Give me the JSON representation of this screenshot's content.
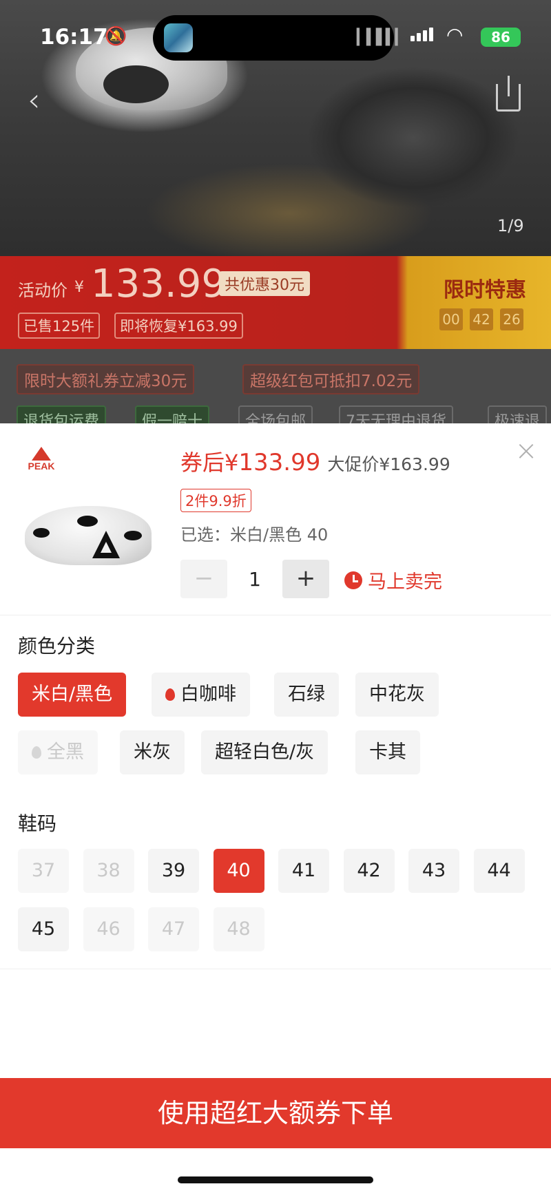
{
  "status_bar": {
    "time": "16:17",
    "battery": "86"
  },
  "gallery": {
    "pager": "1/9"
  },
  "promo": {
    "label": "活动价",
    "yen": "¥",
    "price": "133.99",
    "save_badge": "共优惠30元",
    "sold": "已售125件",
    "restore": "即将恢复¥163.99",
    "flash_title": "限时特惠",
    "countdown": [
      "00",
      "42",
      "26"
    ]
  },
  "coupons": [
    "限时大额礼券立减30元",
    "超级红包可抵扣7.02元"
  ],
  "services": [
    "退货包运费",
    "假一赔十",
    "全场包邮",
    "7天无理由退货",
    "极速退"
  ],
  "sheet": {
    "brand": "PEAK",
    "coupon_price_prefix": "券后¥",
    "coupon_price": "133.99",
    "original_price": "大促价¥163.99",
    "discount_tag": "2件9.9折",
    "selected": "已选：米白/黑色 40",
    "minus": "−",
    "quantity": "1",
    "plus": "+",
    "sold_out_hint": "马上卖完",
    "color_title": "颜色分类",
    "colors": [
      {
        "label": "米白/黑色",
        "state": "selected",
        "hot": false
      },
      {
        "label": "白咖啡",
        "state": "normal",
        "hot": true
      },
      {
        "label": "石绿",
        "state": "normal",
        "hot": false
      },
      {
        "label": "中花灰",
        "state": "normal",
        "hot": false
      },
      {
        "label": "全黑",
        "state": "disabled",
        "hot": true
      },
      {
        "label": "米灰",
        "state": "normal",
        "hot": false
      },
      {
        "label": "超轻白色/灰",
        "state": "normal",
        "hot": false
      },
      {
        "label": "卡其",
        "state": "normal",
        "hot": false
      }
    ],
    "size_title": "鞋码",
    "sizes": [
      {
        "label": "37",
        "state": "disabled"
      },
      {
        "label": "38",
        "state": "disabled"
      },
      {
        "label": "39",
        "state": "normal"
      },
      {
        "label": "40",
        "state": "selected"
      },
      {
        "label": "41",
        "state": "normal"
      },
      {
        "label": "42",
        "state": "normal"
      },
      {
        "label": "43",
        "state": "normal"
      },
      {
        "label": "44",
        "state": "normal"
      },
      {
        "label": "45",
        "state": "normal"
      },
      {
        "label": "46",
        "state": "disabled"
      },
      {
        "label": "47",
        "state": "disabled"
      },
      {
        "label": "48",
        "state": "disabled"
      }
    ],
    "cta": "使用超红大额券下单"
  },
  "colors": {
    "accent": "#e2392c",
    "promo_red": "#c3221c",
    "battery_green": "#34c759"
  }
}
